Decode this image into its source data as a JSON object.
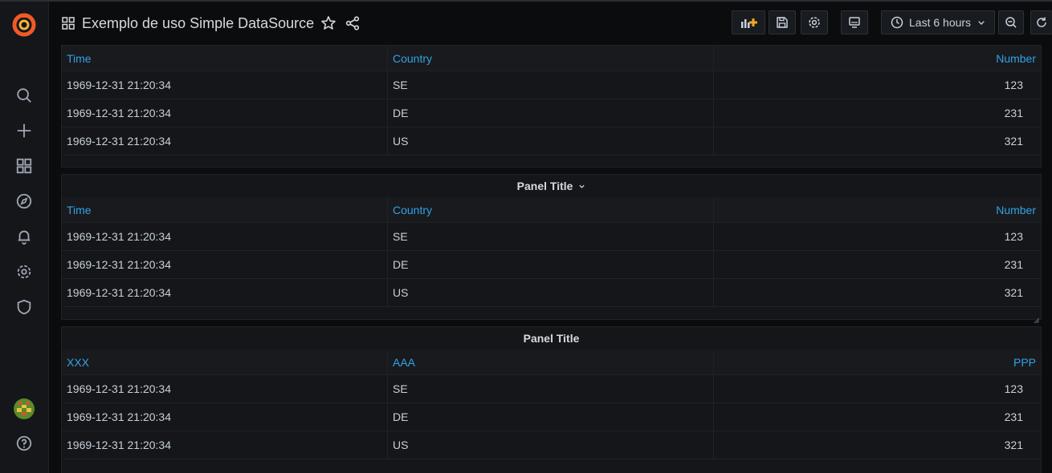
{
  "header": {
    "title": "Exemplo de uso Simple DataSource",
    "time_range": "Last 6 hours"
  },
  "sidebar": {
    "items": [
      "search-icon",
      "plus-icon",
      "dashboards-icon",
      "compass-icon",
      "bell-icon",
      "gear-icon",
      "shield-icon",
      "help-icon"
    ]
  },
  "colors": {
    "accent_link": "#33a2e5",
    "logo_orange": "#f05a28",
    "add_panel_orange": "#f5a623"
  },
  "panels": [
    {
      "title": "",
      "columns": [
        "Time",
        "Country",
        "Number"
      ],
      "rows": [
        [
          "1969-12-31 21:20:34",
          "SE",
          "123"
        ],
        [
          "1969-12-31 21:20:34",
          "DE",
          "231"
        ],
        [
          "1969-12-31 21:20:34",
          "US",
          "321"
        ]
      ]
    },
    {
      "title": "Panel Title",
      "columns": [
        "Time",
        "Country",
        "Number"
      ],
      "rows": [
        [
          "1969-12-31 21:20:34",
          "SE",
          "123"
        ],
        [
          "1969-12-31 21:20:34",
          "DE",
          "231"
        ],
        [
          "1969-12-31 21:20:34",
          "US",
          "321"
        ]
      ]
    },
    {
      "title": "Panel Title",
      "columns": [
        "XXX",
        "AAA",
        "PPP"
      ],
      "rows": [
        [
          "1969-12-31 21:20:34",
          "SE",
          "123"
        ],
        [
          "1969-12-31 21:20:34",
          "DE",
          "231"
        ],
        [
          "1969-12-31 21:20:34",
          "US",
          "321"
        ]
      ]
    }
  ]
}
